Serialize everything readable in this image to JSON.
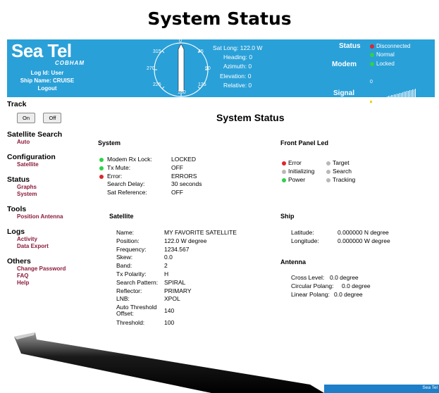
{
  "page_heading": "System Status",
  "header": {
    "logo": "Sea Tel",
    "logo_sub": "COBHAM",
    "log_id": "Log Id: User",
    "ship_name": "Ship Name: CRUISE",
    "logout": "Logout",
    "compass": {
      "labels": [
        "0",
        "45",
        "90",
        "135",
        "180",
        "225",
        "270",
        "315"
      ],
      "heading_deg": 0
    },
    "readouts": {
      "sat_long": "Sat Long: 122.0 W",
      "heading": "Heading: 0",
      "azimuth": "Azimuth: 0",
      "elevation": "Elevation: 0",
      "relative": "Relative: 0"
    },
    "status_label": "Status",
    "modem_label": "Modem",
    "signal_label": "Signal",
    "status_items": [
      "Disconnected",
      "Normal",
      "Locked"
    ],
    "signal_value": "0",
    "colors": {
      "header_bg": "#2aa0d8",
      "red": "#e0262c",
      "green": "#2ed14a",
      "gray": "#b8b8b8"
    }
  },
  "sidebar": {
    "track": {
      "title": "Track",
      "on": "On",
      "off": "Off"
    },
    "sections": [
      {
        "title": "Satellite Search",
        "links": [
          "Auto"
        ]
      },
      {
        "title": "Configuration",
        "links": [
          "Satellite"
        ]
      },
      {
        "title": "Status",
        "links": [
          "Graphs",
          "System"
        ]
      },
      {
        "title": "Tools",
        "links": [
          "Position Antenna"
        ]
      },
      {
        "title": "Logs",
        "links": [
          "Activity",
          "Data Export"
        ]
      },
      {
        "title": "Others",
        "links": [
          "Change Password",
          "FAQ",
          "Help"
        ]
      }
    ]
  },
  "main": {
    "title": "System Status",
    "system": {
      "title": "System",
      "rows": [
        {
          "dot": "green",
          "label": "Modem Rx Lock:",
          "value": "LOCKED"
        },
        {
          "dot": "green",
          "label": "Tx Mute:",
          "value": "OFF"
        },
        {
          "dot": "red",
          "label": "Error:",
          "value": "ERRORS"
        },
        {
          "dot": "",
          "label": "Search Delay:",
          "value": "30 seconds"
        },
        {
          "dot": "",
          "label": "Sat Reference:",
          "value": "OFF"
        }
      ]
    },
    "front_panel": {
      "title": "Front Panel Led",
      "leds": [
        {
          "dot": "red",
          "label": "Error"
        },
        {
          "dot": "gray",
          "label": "Initializing"
        },
        {
          "dot": "green",
          "label": "Power"
        },
        {
          "dot": "gray",
          "label": "Target"
        },
        {
          "dot": "gray",
          "label": "Search"
        },
        {
          "dot": "gray",
          "label": "Tracking"
        }
      ]
    },
    "satellite": {
      "title": "Satellite",
      "rows": [
        {
          "label": "Name:",
          "value": "MY FAVORITE SATELLITE"
        },
        {
          "label": "Position:",
          "value": "122.0 W degree"
        },
        {
          "label": "Frequency:",
          "value": "1234.567"
        },
        {
          "label": "Skew:",
          "value": "0.0"
        },
        {
          "label": "Band:",
          "value": "2"
        },
        {
          "label": "Tx Polarity:",
          "value": "H"
        },
        {
          "label": "Search Pattern:",
          "value": "SPIRAL"
        },
        {
          "label": "Reflector:",
          "value": "PRIMARY"
        },
        {
          "label": "LNB:",
          "value": "XPOL"
        },
        {
          "label": "Auto Threshold",
          "label2": "Offset:",
          "value": "140"
        },
        {
          "label": "Threshold:",
          "value": "100"
        }
      ]
    },
    "ship": {
      "title": "Ship",
      "rows": [
        {
          "label": "Latitude:",
          "value": "0.000000 N degree"
        },
        {
          "label": "Longitude:",
          "value": "0.000000 W degree"
        }
      ]
    },
    "antenna": {
      "title": "Antenna",
      "rows": [
        {
          "label": "Cross Level:",
          "value": "0.0 degree"
        },
        {
          "label": "Circular Polang:",
          "value": "0.0 degree"
        },
        {
          "label": "Linear Polang:",
          "value": "0.0 degree"
        }
      ]
    }
  },
  "taskbar": {
    "text": "Sea Tel"
  }
}
